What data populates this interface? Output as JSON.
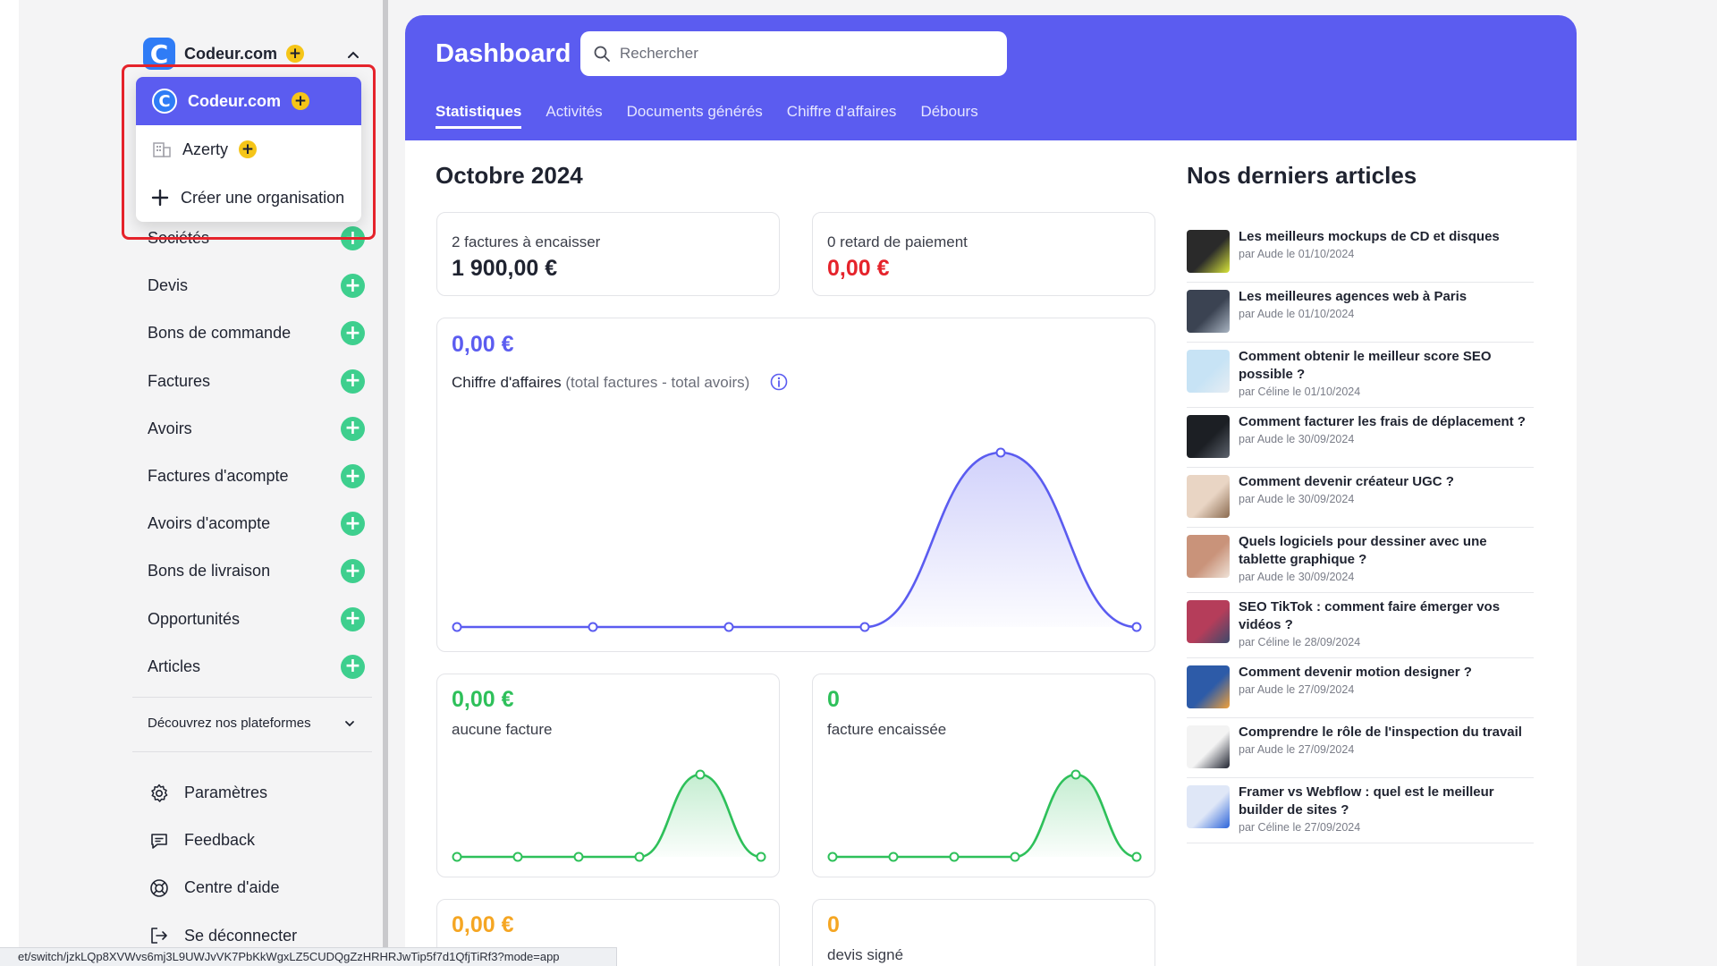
{
  "organization": {
    "current_name": "Codeur.com",
    "dropdown": [
      {
        "name": "Codeur.com",
        "active": true
      },
      {
        "name": "Azerty",
        "active": false
      }
    ],
    "create_label": "Créer une organisation"
  },
  "sidebar": {
    "items": [
      {
        "label": "Sociétés"
      },
      {
        "label": "Devis"
      },
      {
        "label": "Bons de commande"
      },
      {
        "label": "Factures"
      },
      {
        "label": "Avoirs"
      },
      {
        "label": "Factures d'acompte"
      },
      {
        "label": "Avoirs d'acompte"
      },
      {
        "label": "Bons de livraison"
      },
      {
        "label": "Opportunités"
      },
      {
        "label": "Articles"
      }
    ],
    "discover_label": "Découvrez nos plateformes",
    "bottom": [
      {
        "label": "Paramètres",
        "icon": "gear-icon"
      },
      {
        "label": "Feedback",
        "icon": "chat-bubble-icon"
      },
      {
        "label": "Centre d'aide",
        "icon": "lifebuoy-icon"
      },
      {
        "label": "Se déconnecter",
        "icon": "logout-icon"
      }
    ]
  },
  "status_url": "et/switch/jzkLQp8XVWvs6mj3L9UWJvVK7PbKkWgxLZ5CUDQgZzHRHRJwTip5f7d1QfjTiRf3?mode=app",
  "header": {
    "title": "Dashboard",
    "search_placeholder": "Rechercher",
    "tabs": [
      {
        "label": "Statistiques",
        "active": true
      },
      {
        "label": "Activités",
        "active": false
      },
      {
        "label": "Documents générés",
        "active": false
      },
      {
        "label": "Chiffre d'affaires",
        "active": false
      },
      {
        "label": "Débours",
        "active": false
      }
    ]
  },
  "stats": {
    "month": "Octobre 2024",
    "to_collect_label": "2 factures à encaisser",
    "to_collect_value": "1 900,00 €",
    "late_label": "0 retard de paiement",
    "late_value": "0,00 €",
    "revenue_value": "0,00 €",
    "revenue_label": "Chiffre d'affaires",
    "revenue_sub": "(total factures - total avoirs)",
    "invoices_value": "0,00 €",
    "invoices_label": "aucune facture",
    "collected_value": "0",
    "collected_label": "facture encaissée",
    "quotes_value": "0,00 €",
    "signed_value": "0",
    "signed_label": "devis signé"
  },
  "colors": {
    "accent": "#5b5cf0",
    "green": "#2ec05a",
    "red": "#e5232b",
    "orange": "#f5a623",
    "add_button": "#3ecf8e"
  },
  "chart_data": [
    {
      "type": "area",
      "series": [
        {
          "values": [
            0,
            0,
            0,
            0,
            1,
            0
          ]
        }
      ],
      "color": "#5b5cf0"
    },
    {
      "type": "area",
      "series": [
        {
          "values": [
            0,
            0,
            0,
            0,
            1,
            0
          ]
        }
      ],
      "color": "#2ec05a"
    },
    {
      "type": "area",
      "series": [
        {
          "values": [
            0,
            0,
            0,
            0,
            1,
            0
          ]
        }
      ],
      "color": "#2ec05a"
    }
  ],
  "articles": {
    "title": "Nos derniers articles",
    "items": [
      {
        "title": "Les meilleurs mockups de CD et disques",
        "meta": "par Aude le 01/10/2024"
      },
      {
        "title": "Les meilleures agences web à Paris",
        "meta": "par Aude le 01/10/2024"
      },
      {
        "title": "Comment obtenir le meilleur score SEO possible ?",
        "meta": "par Céline le 01/10/2024"
      },
      {
        "title": "Comment facturer les frais de déplacement ?",
        "meta": "par Aude le 30/09/2024"
      },
      {
        "title": "Comment devenir créateur UGC ?",
        "meta": "par Aude le 30/09/2024"
      },
      {
        "title": "Quels logiciels pour dessiner avec une tablette graphique ?",
        "meta": "par Aude le 30/09/2024"
      },
      {
        "title": "SEO TikTok : comment faire émerger vos vidéos ?",
        "meta": "par Céline le 28/09/2024"
      },
      {
        "title": "Comment devenir motion designer ?",
        "meta": "par Aude le 27/09/2024"
      },
      {
        "title": "Comprendre le rôle de l'inspection du travail",
        "meta": "par Aude le 27/09/2024"
      },
      {
        "title": "Framer vs Webflow : quel est le meilleur builder de sites ?",
        "meta": "par Céline le 27/09/2024"
      }
    ]
  }
}
